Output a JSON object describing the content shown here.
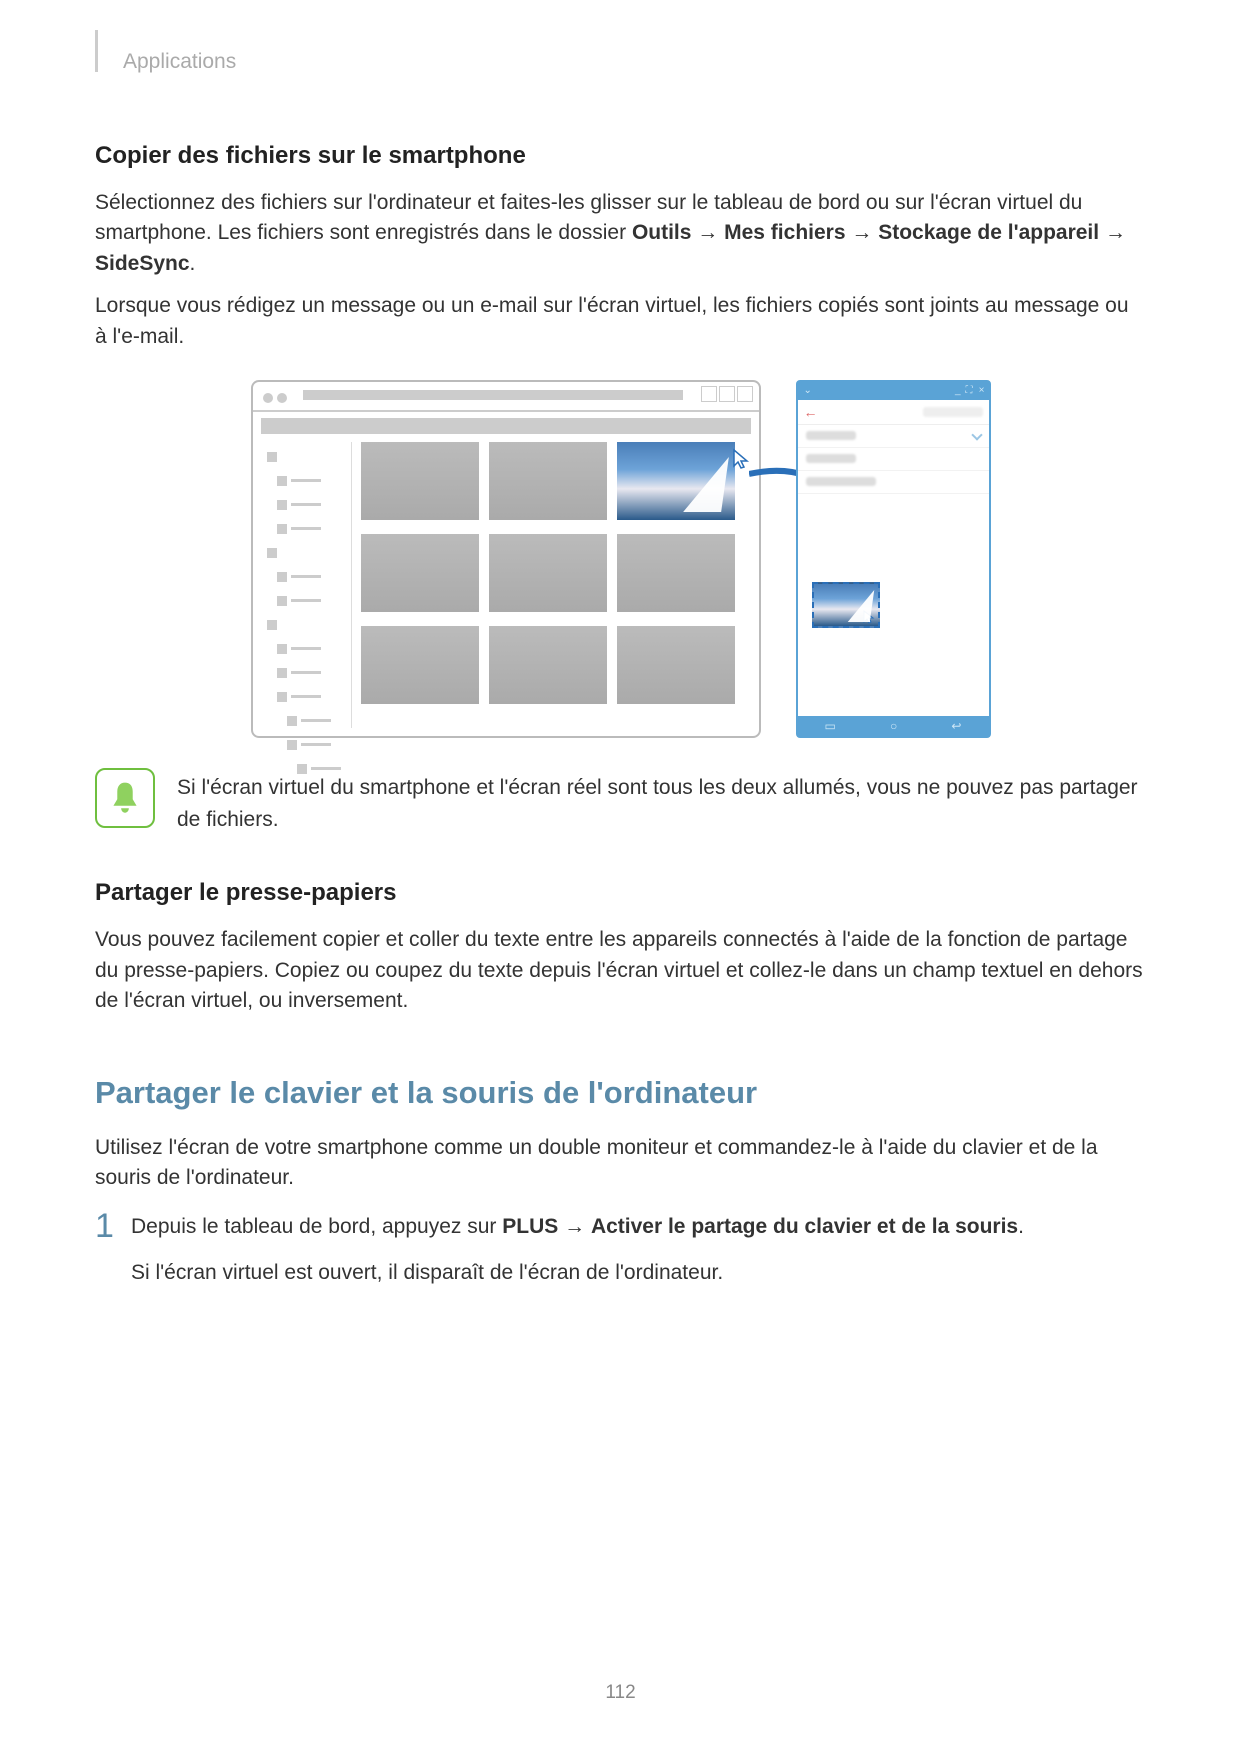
{
  "breadcrumb": "Applications",
  "heading1": "Copier des fichiers sur le smartphone",
  "para1_a": "Sélectionnez des fichiers sur l'ordinateur et faites-les glisser sur le tableau de bord ou sur l'écran virtuel du smartphone. Les fichiers sont enregistrés dans le dossier ",
  "para1_b1": "Outils",
  "para1_arrow": " → ",
  "para1_b2": "Mes fichiers",
  "para1_b3": "Stockage de l'appareil",
  "para1_b4": "SideSync",
  "para1_end": ".",
  "para2": "Lorsque vous rédigez un message ou un e-mail sur l'écran virtuel, les fichiers copiés sont joints au message ou à l'e-mail.",
  "callout_text": "Si l'écran virtuel du smartphone et l'écran réel sont tous les deux allumés, vous ne pouvez pas partager de fichiers.",
  "heading2": "Partager le presse-papiers",
  "para3": "Vous pouvez facilement copier et coller du texte entre les appareils connectés à l'aide de la fonction de partage du presse-papiers. Copiez ou coupez du texte depuis l'écran virtuel et collez-le dans un champ textuel en dehors de l'écran virtuel, ou inversement.",
  "section_heading": "Partager le clavier et la souris de l'ordinateur",
  "para4": "Utilisez l'écran de votre smartphone comme un double moniteur et commandez-le à l'aide du clavier et de la souris de l'ordinateur.",
  "step1_num": "1",
  "step1_a": "Depuis le tableau de bord, appuyez sur ",
  "step1_b1": "PLUS",
  "step1_b2": "Activer le partage du clavier et de la souris",
  "step1_end": ".",
  "step1_line2": "Si l'écran virtuel est ouvert, il disparaît de l'écran de l'ordinateur.",
  "page_number": "112"
}
